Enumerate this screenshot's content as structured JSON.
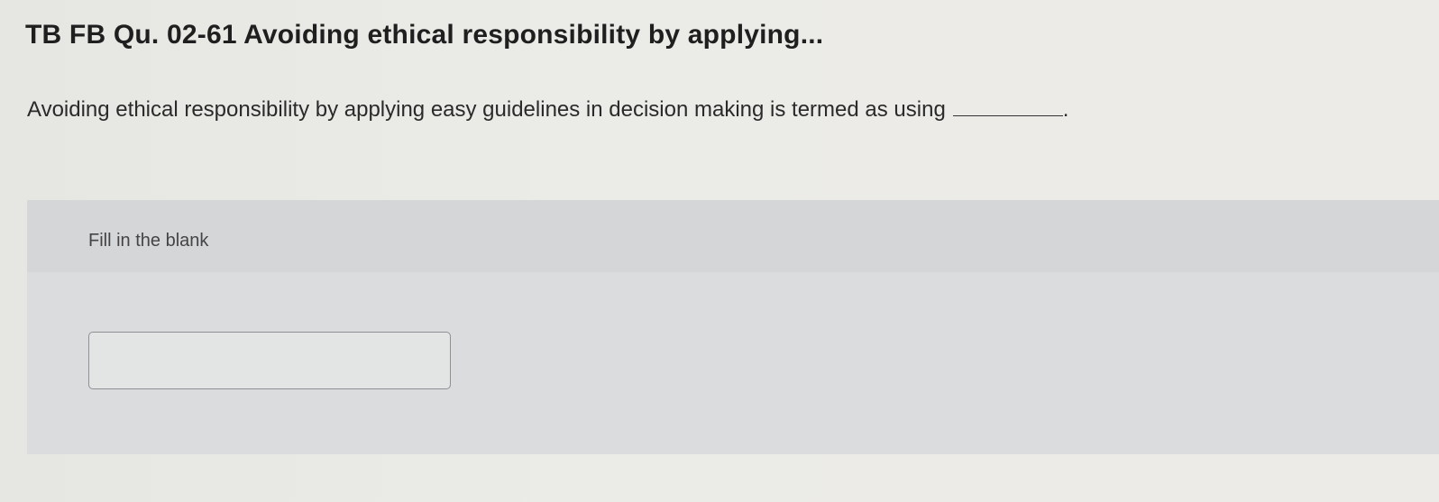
{
  "page": {
    "title": "TB FB Qu. 02-61 Avoiding ethical responsibility by applying...",
    "question_text": "Avoiding ethical responsibility by applying easy guidelines in decision making is termed as using",
    "question_end": "."
  },
  "answer_panel": {
    "instruction": "Fill in the blank",
    "input_value": "",
    "input_placeholder": ""
  },
  "colors": {
    "background": "#ebebe7",
    "panel": "#dadcdd",
    "panel_header": "#d4d6d8",
    "input_border": "#8e9094"
  }
}
